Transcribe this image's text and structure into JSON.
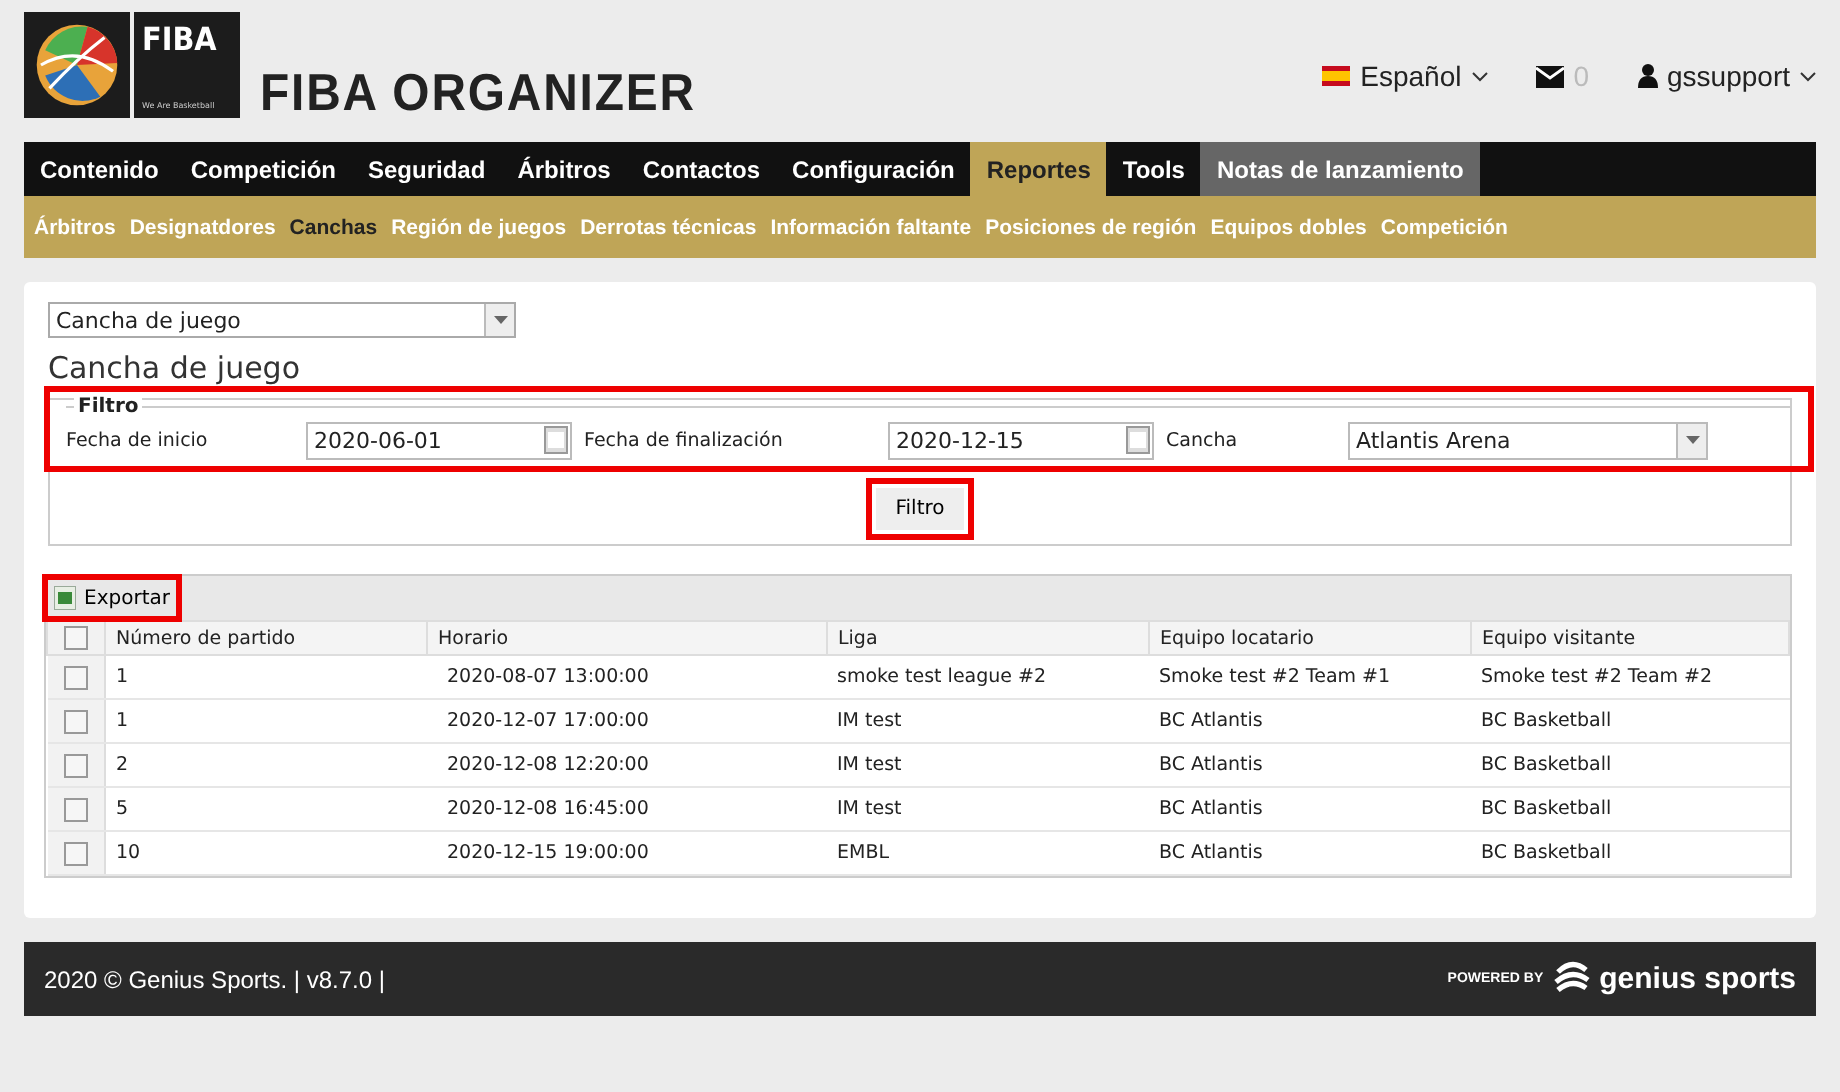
{
  "logo": {
    "badge": "FIBA",
    "tagline": "We Are Basketball",
    "title": "FIBA ORGANIZER"
  },
  "header": {
    "language": "Español",
    "messages": "0",
    "user": "gssupport"
  },
  "nav": [
    {
      "label": "Contenido",
      "selected": false,
      "kind": "menu"
    },
    {
      "label": "Competición",
      "selected": false,
      "kind": "menu"
    },
    {
      "label": "Seguridad",
      "selected": false,
      "kind": "menu"
    },
    {
      "label": "Árbitros",
      "selected": false,
      "kind": "menu"
    },
    {
      "label": "Contactos",
      "selected": false,
      "kind": "menu"
    },
    {
      "label": "Configuración",
      "selected": false,
      "kind": "menu"
    },
    {
      "label": "Reportes",
      "selected": true,
      "kind": "menu"
    },
    {
      "label": "Tools",
      "selected": false,
      "kind": "menu"
    },
    {
      "label": "Notas de lanzamiento",
      "selected": false,
      "kind": "notes"
    }
  ],
  "subnav": [
    {
      "label": "Árbitros",
      "selected": false
    },
    {
      "label": "Designatdores",
      "selected": false
    },
    {
      "label": "Canchas",
      "selected": true
    },
    {
      "label": "Región de juegos",
      "selected": false
    },
    {
      "label": "Derrotas técnicas",
      "selected": false
    },
    {
      "label": "Información faltante",
      "selected": false
    },
    {
      "label": "Posiciones de región",
      "selected": false
    },
    {
      "label": "Equipos dobles",
      "selected": false
    },
    {
      "label": "Competición",
      "selected": false
    }
  ],
  "report_select": {
    "value": "Cancha de juego"
  },
  "heading": "Cancha de juego",
  "filter": {
    "legend": "Filtro",
    "start_label": "Fecha de inicio",
    "start_value": "2020-06-01",
    "end_label": "Fecha de finalización",
    "end_value": "2020-12-15",
    "court_label": "Cancha",
    "court_value": "Atlantis Arena",
    "button": "Filtro"
  },
  "export_button": "Exportar",
  "table": {
    "header_checked": false,
    "columns": [
      "Número de partido",
      "Horario",
      "Liga",
      "Equipo locatario",
      "Equipo visitante"
    ],
    "rows": [
      {
        "checked": false,
        "cells": [
          "1",
          "2020-08-07 13:00:00",
          "smoke test league #2",
          "Smoke test #2 Team #1",
          "Smoke test #2 Team #2"
        ]
      },
      {
        "checked": false,
        "cells": [
          "1",
          "2020-12-07 17:00:00",
          "IM test",
          "BC Atlantis",
          "BC Basketball"
        ]
      },
      {
        "checked": false,
        "cells": [
          "2",
          "2020-12-08 12:20:00",
          "IM test",
          "BC Atlantis",
          "BC Basketball"
        ]
      },
      {
        "checked": false,
        "cells": [
          "5",
          "2020-12-08 16:45:00",
          "IM test",
          "BC Atlantis",
          "BC Basketball"
        ]
      },
      {
        "checked": false,
        "cells": [
          "10",
          "2020-12-15 19:00:00",
          "EMBL",
          "BC Atlantis",
          "BC Basketball"
        ]
      }
    ]
  },
  "footer": {
    "copyright": "2020 © Genius Sports. | v8.7.0 |",
    "powered_by": "POWERED BY",
    "brand": "genius sports"
  }
}
